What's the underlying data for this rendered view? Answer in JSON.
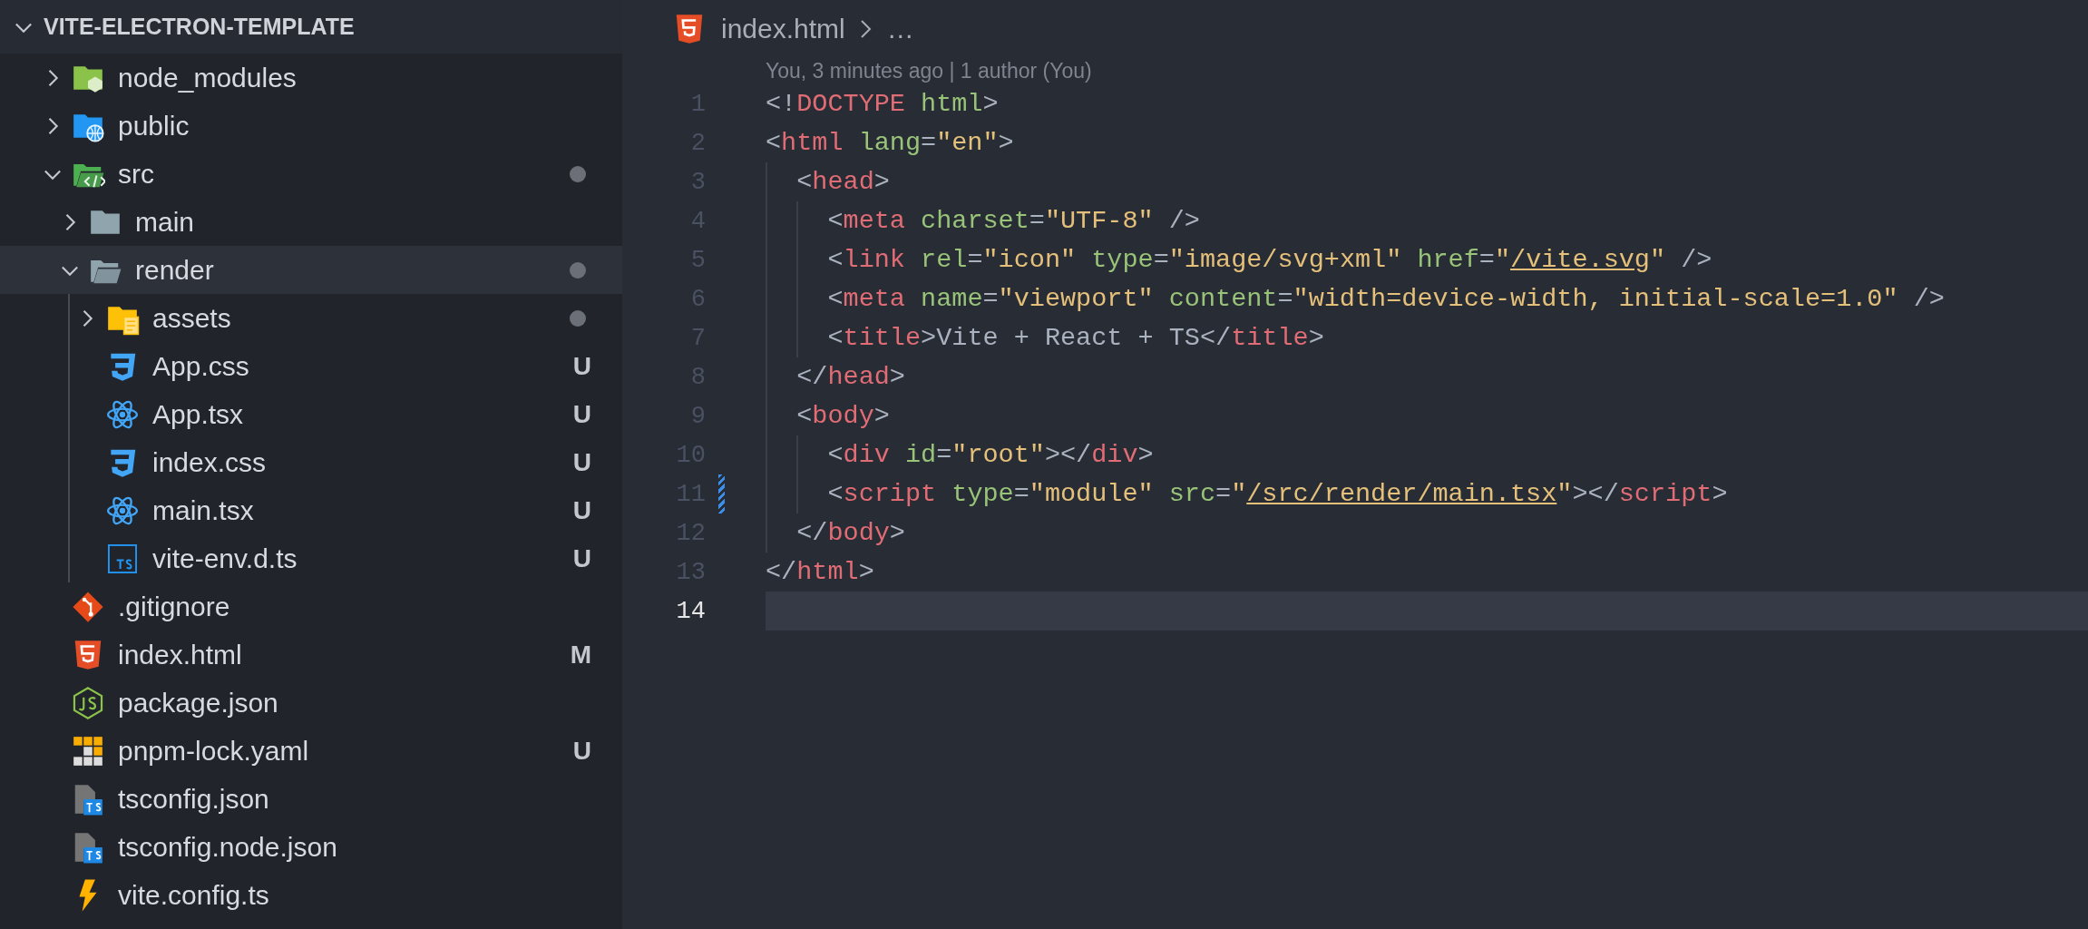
{
  "explorer": {
    "title": "VITE-ELECTRON-TEMPLATE",
    "expanded": true,
    "items": [
      {
        "name": "node_modules",
        "kind": "folder-node",
        "expanded": false,
        "selected": false,
        "has_changes": false
      },
      {
        "name": "public",
        "kind": "folder-public",
        "expanded": false,
        "selected": false,
        "has_changes": false
      },
      {
        "name": "src",
        "kind": "folder-src",
        "expanded": true,
        "selected": false,
        "has_changes": true,
        "children": [
          {
            "name": "main",
            "kind": "folder",
            "expanded": false,
            "selected": false,
            "has_changes": false
          },
          {
            "name": "render",
            "kind": "folder",
            "expanded": true,
            "selected": true,
            "has_changes": true,
            "children": [
              {
                "name": "assets",
                "kind": "folder-assets",
                "expanded": false,
                "selected": false,
                "has_changes": true
              },
              {
                "name": "App.css",
                "kind": "css",
                "selected": false,
                "status": "U"
              },
              {
                "name": "App.tsx",
                "kind": "react",
                "selected": false,
                "status": "U"
              },
              {
                "name": "index.css",
                "kind": "css",
                "selected": false,
                "status": "U"
              },
              {
                "name": "main.tsx",
                "kind": "react",
                "selected": false,
                "status": "U"
              },
              {
                "name": "vite-env.d.ts",
                "kind": "ts",
                "selected": false,
                "status": "U"
              }
            ]
          }
        ]
      },
      {
        "name": ".gitignore",
        "kind": "git",
        "selected": false
      },
      {
        "name": "index.html",
        "kind": "html",
        "selected": false,
        "status": "M"
      },
      {
        "name": "package.json",
        "kind": "nodejs",
        "selected": false
      },
      {
        "name": "pnpm-lock.yaml",
        "kind": "pnpm",
        "selected": false,
        "status": "U"
      },
      {
        "name": "tsconfig.json",
        "kind": "tsconfig",
        "selected": false
      },
      {
        "name": "tsconfig.node.json",
        "kind": "tsconfig",
        "selected": false
      },
      {
        "name": "vite.config.ts",
        "kind": "vite",
        "selected": false
      }
    ]
  },
  "editor": {
    "breadcrumb": {
      "file": "index.html",
      "kind": "html",
      "ellipsis": "…"
    },
    "blame": "You, 3 minutes ago | 1 author (You)",
    "lines": [
      {
        "number": "1",
        "current": false,
        "modified": false,
        "tokens": [
          {
            "kind": "punct",
            "text": "<!"
          },
          {
            "kind": "tag",
            "text": "DOCTYPE"
          },
          {
            "kind": "attr",
            "text": " html"
          },
          {
            "kind": "punct",
            "text": ">"
          }
        ]
      },
      {
        "number": "2",
        "current": false,
        "modified": false,
        "tokens": [
          {
            "kind": "punct",
            "text": "<"
          },
          {
            "kind": "tag",
            "text": "html"
          },
          {
            "kind": "attr",
            "text": " lang"
          },
          {
            "kind": "punct",
            "text": "="
          },
          {
            "kind": "string",
            "text": "\"en\""
          },
          {
            "kind": "punct",
            "text": ">"
          }
        ]
      },
      {
        "number": "3",
        "current": false,
        "modified": false,
        "tokens": [
          {
            "kind": "punct",
            "text": "  <"
          },
          {
            "kind": "tag",
            "text": "head"
          },
          {
            "kind": "punct",
            "text": ">"
          }
        ]
      },
      {
        "number": "4",
        "current": false,
        "modified": false,
        "tokens": [
          {
            "kind": "punct",
            "text": "    <"
          },
          {
            "kind": "tag",
            "text": "meta"
          },
          {
            "kind": "attr",
            "text": " charset"
          },
          {
            "kind": "punct",
            "text": "="
          },
          {
            "kind": "string",
            "text": "\"UTF-8\""
          },
          {
            "kind": "punct",
            "text": " />"
          }
        ]
      },
      {
        "number": "5",
        "current": false,
        "modified": false,
        "tokens": [
          {
            "kind": "punct",
            "text": "    <"
          },
          {
            "kind": "tag",
            "text": "link"
          },
          {
            "kind": "attr",
            "text": " rel"
          },
          {
            "kind": "punct",
            "text": "="
          },
          {
            "kind": "string",
            "text": "\"icon\""
          },
          {
            "kind": "attr",
            "text": " type"
          },
          {
            "kind": "punct",
            "text": "="
          },
          {
            "kind": "string",
            "text": "\"image/svg+xml\""
          },
          {
            "kind": "attr",
            "text": " href"
          },
          {
            "kind": "punct",
            "text": "="
          },
          {
            "kind": "string",
            "text": "\""
          },
          {
            "kind": "link",
            "text": "/vite.svg"
          },
          {
            "kind": "string",
            "text": "\""
          },
          {
            "kind": "punct",
            "text": " />"
          }
        ]
      },
      {
        "number": "6",
        "current": false,
        "modified": false,
        "tokens": [
          {
            "kind": "punct",
            "text": "    <"
          },
          {
            "kind": "tag",
            "text": "meta"
          },
          {
            "kind": "attr",
            "text": " name"
          },
          {
            "kind": "punct",
            "text": "="
          },
          {
            "kind": "string",
            "text": "\"viewport\""
          },
          {
            "kind": "attr",
            "text": " content"
          },
          {
            "kind": "punct",
            "text": "="
          },
          {
            "kind": "string",
            "text": "\"width=device-width, initial-scale=1.0\""
          },
          {
            "kind": "punct",
            "text": " />"
          }
        ]
      },
      {
        "number": "7",
        "current": false,
        "modified": false,
        "tokens": [
          {
            "kind": "punct",
            "text": "    <"
          },
          {
            "kind": "tag",
            "text": "title"
          },
          {
            "kind": "punct",
            "text": ">"
          },
          {
            "kind": "text",
            "text": "Vite + React + TS"
          },
          {
            "kind": "punct",
            "text": "</"
          },
          {
            "kind": "tag",
            "text": "title"
          },
          {
            "kind": "punct",
            "text": ">"
          }
        ]
      },
      {
        "number": "8",
        "current": false,
        "modified": false,
        "tokens": [
          {
            "kind": "punct",
            "text": "  </"
          },
          {
            "kind": "tag",
            "text": "head"
          },
          {
            "kind": "punct",
            "text": ">"
          }
        ]
      },
      {
        "number": "9",
        "current": false,
        "modified": false,
        "tokens": [
          {
            "kind": "punct",
            "text": "  <"
          },
          {
            "kind": "tag",
            "text": "body"
          },
          {
            "kind": "punct",
            "text": ">"
          }
        ]
      },
      {
        "number": "10",
        "current": false,
        "modified": false,
        "tokens": [
          {
            "kind": "punct",
            "text": "    <"
          },
          {
            "kind": "tag",
            "text": "div"
          },
          {
            "kind": "attr",
            "text": " id"
          },
          {
            "kind": "punct",
            "text": "="
          },
          {
            "kind": "string",
            "text": "\"root\""
          },
          {
            "kind": "punct",
            "text": "></"
          },
          {
            "kind": "tag",
            "text": "div"
          },
          {
            "kind": "punct",
            "text": ">"
          }
        ]
      },
      {
        "number": "11",
        "current": false,
        "modified": true,
        "tokens": [
          {
            "kind": "punct",
            "text": "    <"
          },
          {
            "kind": "tag",
            "text": "script"
          },
          {
            "kind": "attr",
            "text": " type"
          },
          {
            "kind": "punct",
            "text": "="
          },
          {
            "kind": "string",
            "text": "\"module\""
          },
          {
            "kind": "attr",
            "text": " src"
          },
          {
            "kind": "punct",
            "text": "="
          },
          {
            "kind": "string",
            "text": "\""
          },
          {
            "kind": "link",
            "text": "/src/render/main.tsx"
          },
          {
            "kind": "string",
            "text": "\""
          },
          {
            "kind": "punct",
            "text": "></"
          },
          {
            "kind": "tag",
            "text": "script"
          },
          {
            "kind": "punct",
            "text": ">"
          }
        ]
      },
      {
        "number": "12",
        "current": false,
        "modified": false,
        "tokens": [
          {
            "kind": "punct",
            "text": "  </"
          },
          {
            "kind": "tag",
            "text": "body"
          },
          {
            "kind": "punct",
            "text": ">"
          }
        ]
      },
      {
        "number": "13",
        "current": false,
        "modified": false,
        "tokens": [
          {
            "kind": "punct",
            "text": "</"
          },
          {
            "kind": "tag",
            "text": "html"
          },
          {
            "kind": "punct",
            "text": ">"
          }
        ]
      },
      {
        "number": "14",
        "current": true,
        "modified": false
      }
    ]
  }
}
